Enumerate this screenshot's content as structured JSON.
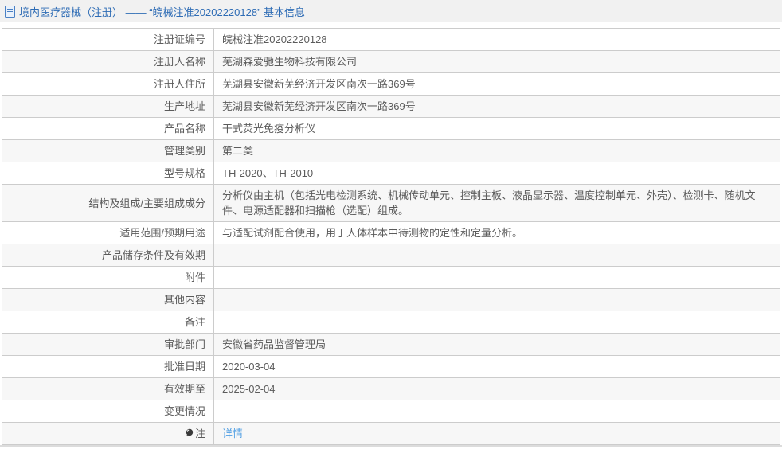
{
  "header": {
    "title": "境内医疗器械（注册） —— “皖械注准20202220128” 基本信息"
  },
  "colors": {
    "header_bg": "#f1f1f1",
    "header_text": "#2e6cb5",
    "table_border": "#cccccc",
    "row_alt_bg": "#f7f7f7",
    "body_text": "#5b5b5b",
    "link": "#4f9ee3"
  },
  "icons": {
    "header_icon": "document-icon",
    "note_row_icon": "note-icon"
  },
  "table": {
    "rows": [
      {
        "label": "注册证编号",
        "value": "皖械注准20202220128"
      },
      {
        "label": "注册人名称",
        "value": "芜湖森爱驰生物科技有限公司"
      },
      {
        "label": "注册人住所",
        "value": "芜湖县安徽新芜经济开发区南次一路369号"
      },
      {
        "label": "生产地址",
        "value": "芜湖县安徽新芜经济开发区南次一路369号"
      },
      {
        "label": "产品名称",
        "value": "干式荧光免疫分析仪"
      },
      {
        "label": "管理类别",
        "value": "第二类"
      },
      {
        "label": "型号规格",
        "value": "TH-2020、TH-2010"
      },
      {
        "label": "结构及组成/主要组成成分",
        "value": "分析仪由主机（包括光电检测系统、机械传动单元、控制主板、液晶显示器、温度控制单元、外壳）、检测卡、随机文件、电源适配器和扫描枪（选配）组成。"
      },
      {
        "label": "适用范围/预期用途",
        "value": "与适配试剂配合使用，用于人体样本中待测物的定性和定量分析。"
      },
      {
        "label": "产品储存条件及有效期",
        "value": ""
      },
      {
        "label": "附件",
        "value": ""
      },
      {
        "label": "其他内容",
        "value": ""
      },
      {
        "label": "备注",
        "value": ""
      },
      {
        "label": "审批部门",
        "value": "安徽省药品监督管理局"
      },
      {
        "label": "批准日期",
        "value": "2020-03-04"
      },
      {
        "label": "有效期至",
        "value": "2025-02-04"
      },
      {
        "label": "变更情况",
        "value": ""
      },
      {
        "label": "注",
        "value_link": "详情"
      }
    ]
  }
}
